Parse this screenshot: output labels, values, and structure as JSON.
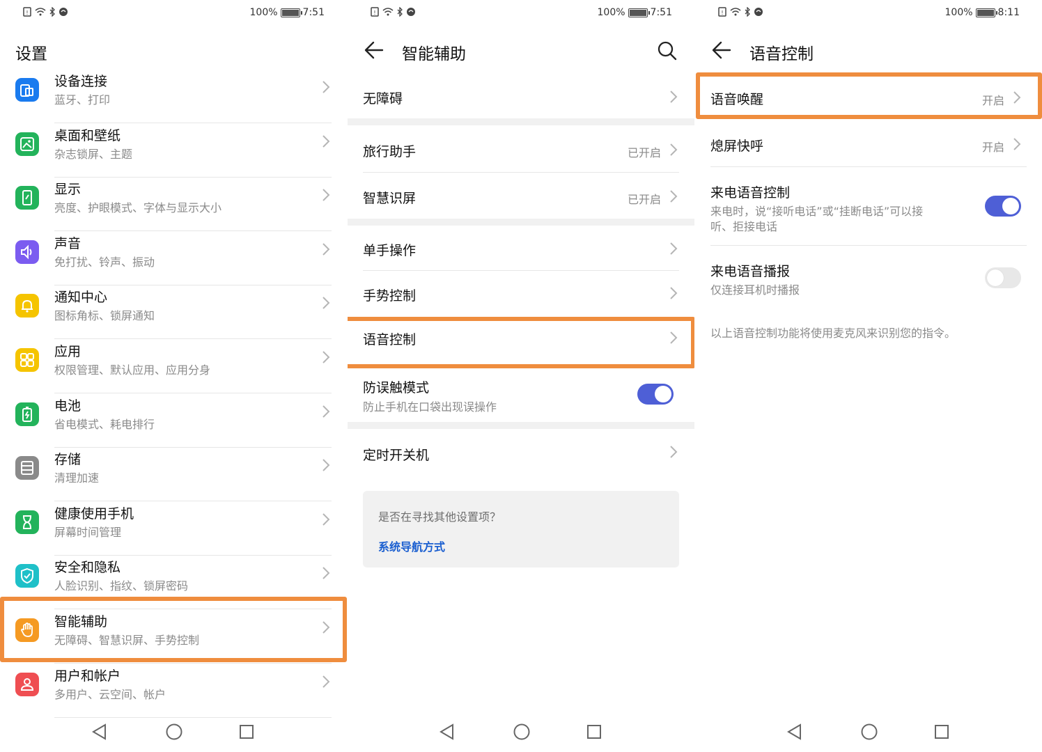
{
  "status": {
    "panel1": {
      "battery": "100%",
      "time": "7:51"
    },
    "panel2": {
      "battery": "100%",
      "time": "7:51"
    },
    "panel3": {
      "battery": "100%",
      "time": "8:11"
    }
  },
  "settings": {
    "title": "设置",
    "items": [
      {
        "title": "设备连接",
        "sub": "蓝牙、打印",
        "icon": "device-connection-icon",
        "color": "#1a7bef"
      },
      {
        "title": "桌面和壁纸",
        "sub": "杂志锁屏、主题",
        "icon": "wallpaper-icon",
        "color": "#23b35b"
      },
      {
        "title": "显示",
        "sub": "亮度、护眼模式、字体与显示大小",
        "icon": "display-icon",
        "color": "#23b35b"
      },
      {
        "title": "声音",
        "sub": "免打扰、铃声、振动",
        "icon": "sound-icon",
        "color": "#7b5cf0"
      },
      {
        "title": "通知中心",
        "sub": "图标角标、锁屏通知",
        "icon": "notification-bell-icon",
        "color": "#f5c400"
      },
      {
        "title": "应用",
        "sub": "权限管理、默认应用、应用分身",
        "icon": "apps-grid-icon",
        "color": "#f5c400"
      },
      {
        "title": "电池",
        "sub": "省电模式、耗电排行",
        "icon": "battery-icon",
        "color": "#23b35b"
      },
      {
        "title": "存储",
        "sub": "清理加速",
        "icon": "storage-icon",
        "color": "#8a8a8a"
      },
      {
        "title": "健康使用手机",
        "sub": "屏幕时间管理",
        "icon": "hourglass-icon",
        "color": "#23b35b"
      },
      {
        "title": "安全和隐私",
        "sub": "人脸识别、指纹、锁屏密码",
        "icon": "shield-icon",
        "color": "#1fc0c8"
      },
      {
        "title": "智能辅助",
        "sub": "无障碍、智慧识屏、手势控制",
        "icon": "hand-icon",
        "color": "#f59a23"
      },
      {
        "title": "用户和帐户",
        "sub": "多用户、云空间、帐户",
        "icon": "user-icon",
        "color": "#ef4e52"
      }
    ]
  },
  "assist": {
    "title": "智能辅助",
    "items": {
      "accessibility": "无障碍",
      "travel": "旅行助手",
      "travel_value": "已开启",
      "smart_screen": "智慧识屏",
      "smart_screen_value": "已开启",
      "one_hand": "单手操作",
      "gesture": "手势控制",
      "voice": "语音控制",
      "pocket": "防误触模式",
      "pocket_sub": "防止手机在口袋出现误操作",
      "pocket_toggle": "on",
      "schedule": "定时开关机"
    },
    "suggest_question": "是否在寻找其他设置项？",
    "suggest_link": "系统导航方式"
  },
  "voice": {
    "title": "语音控制",
    "wake": "语音唤醒",
    "wake_value": "开启",
    "quick_call": "熄屏快呼",
    "quick_call_value": "开启",
    "call_control": "来电语音控制",
    "call_control_sub1": "来电时，说“接听电话”或“挂断电话”可以接",
    "call_control_sub2": "听、拒接电话",
    "call_control_toggle": "on",
    "call_announce": "来电语音播报",
    "call_announce_sub": "仅连接耳机时播报",
    "call_announce_toggle": "off",
    "note": "以上语音控制功能将使用麦克风来识别您的指令。"
  },
  "colors": {
    "highlight": "#ef8d3e",
    "toggle_on": "#4e5fd6",
    "link": "#1b5fd0"
  }
}
